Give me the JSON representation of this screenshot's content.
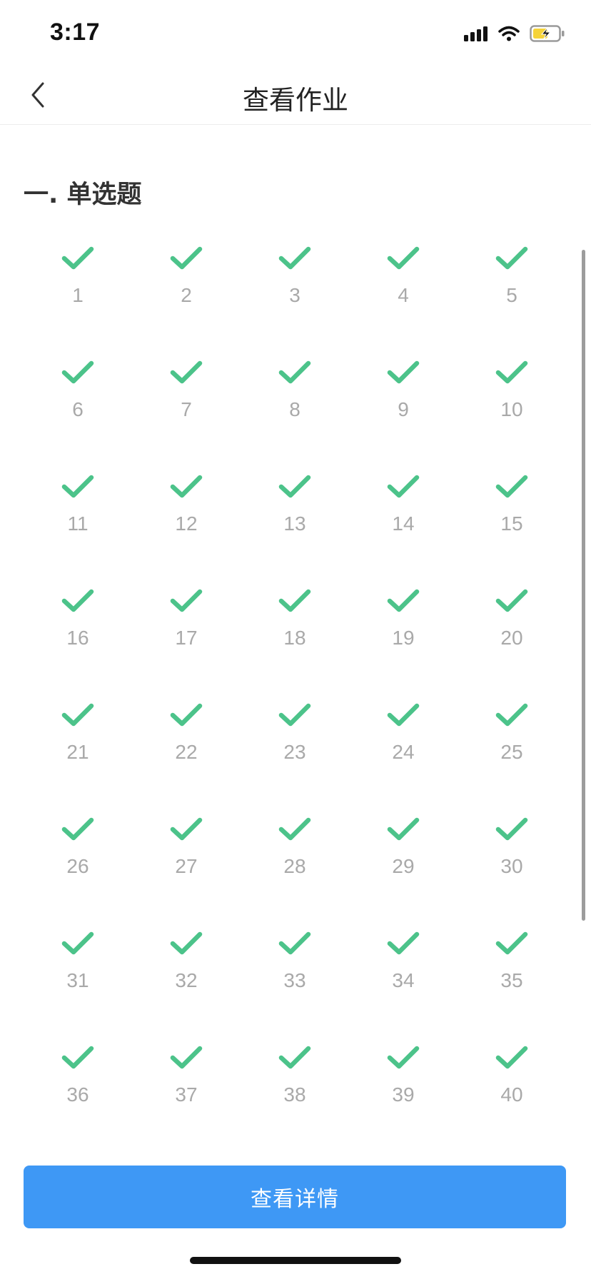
{
  "status_bar": {
    "time": "3:17"
  },
  "nav": {
    "title": "查看作业"
  },
  "section": {
    "title": "一. 单选题"
  },
  "questions": [
    {
      "number": "1",
      "status": "correct"
    },
    {
      "number": "2",
      "status": "correct"
    },
    {
      "number": "3",
      "status": "correct"
    },
    {
      "number": "4",
      "status": "correct"
    },
    {
      "number": "5",
      "status": "correct"
    },
    {
      "number": "6",
      "status": "correct"
    },
    {
      "number": "7",
      "status": "correct"
    },
    {
      "number": "8",
      "status": "correct"
    },
    {
      "number": "9",
      "status": "correct"
    },
    {
      "number": "10",
      "status": "correct"
    },
    {
      "number": "11",
      "status": "correct"
    },
    {
      "number": "12",
      "status": "correct"
    },
    {
      "number": "13",
      "status": "correct"
    },
    {
      "number": "14",
      "status": "correct"
    },
    {
      "number": "15",
      "status": "correct"
    },
    {
      "number": "16",
      "status": "correct"
    },
    {
      "number": "17",
      "status": "correct"
    },
    {
      "number": "18",
      "status": "correct"
    },
    {
      "number": "19",
      "status": "correct"
    },
    {
      "number": "20",
      "status": "correct"
    },
    {
      "number": "21",
      "status": "correct"
    },
    {
      "number": "22",
      "status": "correct"
    },
    {
      "number": "23",
      "status": "correct"
    },
    {
      "number": "24",
      "status": "correct"
    },
    {
      "number": "25",
      "status": "correct"
    },
    {
      "number": "26",
      "status": "correct"
    },
    {
      "number": "27",
      "status": "correct"
    },
    {
      "number": "28",
      "status": "correct"
    },
    {
      "number": "29",
      "status": "correct"
    },
    {
      "number": "30",
      "status": "correct"
    },
    {
      "number": "31",
      "status": "correct"
    },
    {
      "number": "32",
      "status": "correct"
    },
    {
      "number": "33",
      "status": "correct"
    },
    {
      "number": "34",
      "status": "correct"
    },
    {
      "number": "35",
      "status": "correct"
    },
    {
      "number": "36",
      "status": "correct"
    },
    {
      "number": "37",
      "status": "correct"
    },
    {
      "number": "38",
      "status": "correct"
    },
    {
      "number": "39",
      "status": "correct"
    },
    {
      "number": "40",
      "status": "correct"
    }
  ],
  "footer": {
    "detail_button_label": "查看详情"
  },
  "colors": {
    "check_green": "#4cc38a",
    "number_gray": "#a9a9a9",
    "button_blue": "#3e98f5",
    "battery_yellow": "#f5d33a"
  },
  "icons": {
    "back": "chevron-left-icon",
    "check": "checkmark-icon",
    "signal": "cellular-signal-icon",
    "wifi": "wifi-icon",
    "battery": "battery-charging-icon"
  }
}
